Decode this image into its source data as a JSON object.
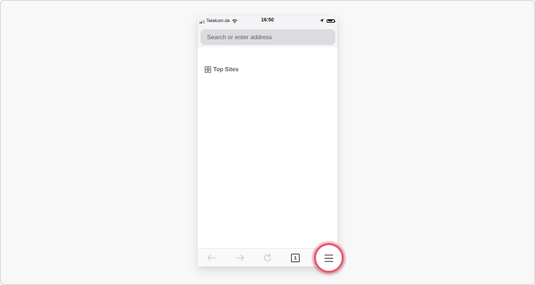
{
  "status_bar": {
    "carrier": "Telekom.de",
    "time": "16:50",
    "battery_level": 0.85
  },
  "address_bar": {
    "placeholder": "Search or enter address"
  },
  "top_sites": {
    "label": "Top Sites"
  },
  "toolbar": {
    "back_icon": "back-arrow-icon",
    "forward_icon": "forward-arrow-icon",
    "reload_icon": "reload-icon",
    "tab_count": "1",
    "menu_icon": "hamburger-menu-icon"
  },
  "colors": {
    "background": "#f8f8f8",
    "chrome": "#f4f4f6",
    "url_field": "#dcdcdf",
    "highlight_ring": "#e35b6f",
    "disabled_icon": "#c9c9cc"
  }
}
